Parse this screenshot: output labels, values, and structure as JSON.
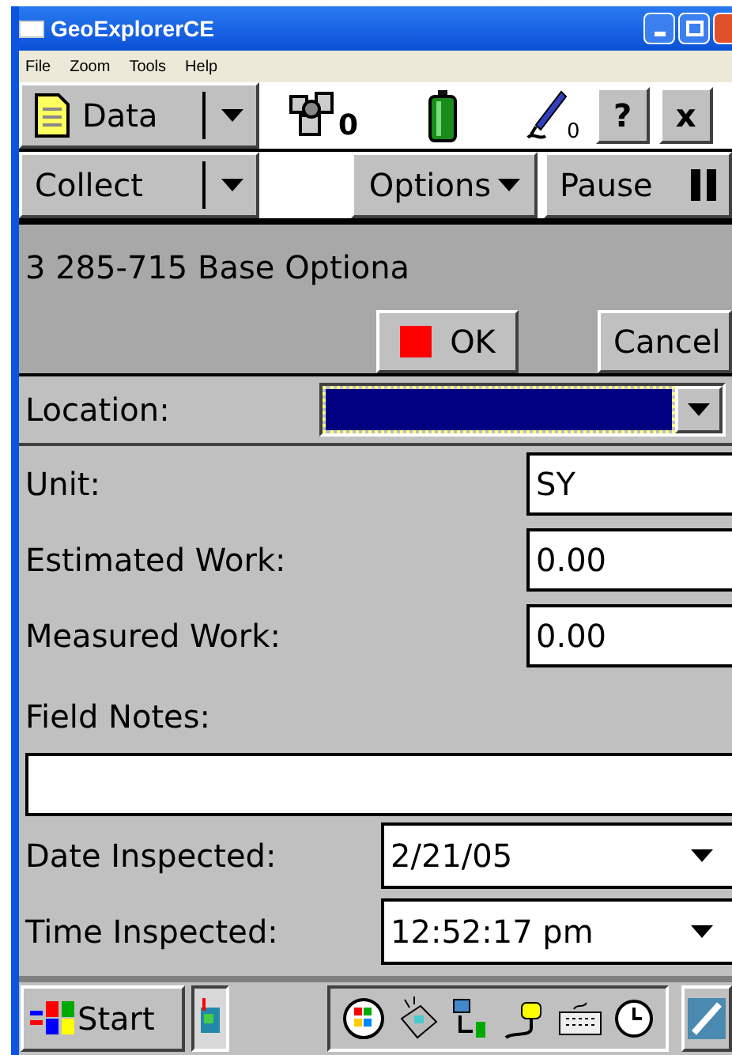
{
  "window": {
    "title": "GeoExplorerCE"
  },
  "menu": [
    "File",
    "Zoom",
    "Tools",
    "Help"
  ],
  "toolbar": {
    "section": "Data",
    "satellites": "0",
    "pen_count": "0",
    "help": "?",
    "close": "x"
  },
  "commands": {
    "mode": "Collect",
    "options": "Options",
    "pause": "Pause"
  },
  "form": {
    "title": "3 285-715 Base Optiona",
    "ok": "OK",
    "cancel": "Cancel"
  },
  "fields": [
    {
      "kind": "dropdown",
      "label": "Location:",
      "focused": true
    },
    {
      "kind": "text",
      "label": "Unit:",
      "value": "SY"
    },
    {
      "kind": "text",
      "label": "Estimated Work:",
      "value": "0.00"
    },
    {
      "kind": "text",
      "label": "Measured Work:",
      "value": "0.00"
    },
    {
      "kind": "notes",
      "label": "Field Notes:"
    },
    {
      "kind": "picker",
      "label": "Date Inspected:",
      "value": "2/21/05"
    },
    {
      "kind": "picker",
      "label": "Time Inspected:",
      "value": "12:52:17 pm"
    }
  ],
  "taskbar": {
    "start": "Start"
  }
}
